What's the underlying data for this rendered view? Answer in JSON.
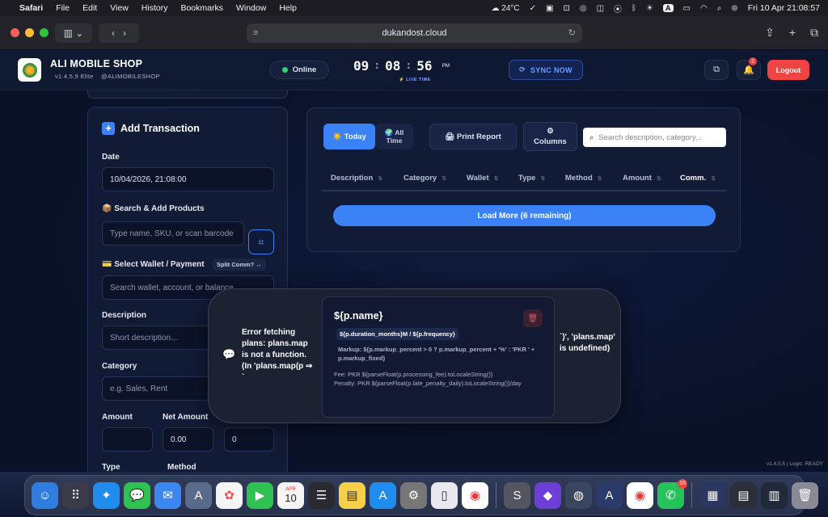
{
  "menubar": {
    "app": "Safari",
    "items": [
      "File",
      "Edit",
      "View",
      "History",
      "Bookmarks",
      "Window",
      "Help"
    ],
    "weather": "24°C",
    "input_source": "A",
    "datetime": "Fri 10 Apr  21:08:57"
  },
  "browser": {
    "url": "dukandost.cloud"
  },
  "header": {
    "shop_name": "ALI MOBILE SHOP",
    "version": "v1.4.5.9 Elite",
    "handle": "@ALIMOBILESHOP",
    "status": "Online",
    "clock": {
      "hh": "09",
      "mm": "08",
      "ss": "56",
      "ampm": "PM"
    },
    "live_label": "⚡ LIVE TIME",
    "sync_label": "SYNC NOW",
    "notif_count": "2",
    "logout_label": "Logout",
    "colors": {
      "accent": "#3b82f6",
      "danger": "#ef4444",
      "online": "#2ed573"
    }
  },
  "add_transaction": {
    "title": "Add Transaction",
    "date_label": "Date",
    "date_value": "10/04/2026, 21:08:00",
    "products_label": "📦 Search & Add Products",
    "products_placeholder": "Type name, SKU, or scan barcode",
    "wallet_label": "💳 Select Wallet / Payment",
    "split_label": "Split Comm? ↔",
    "wallet_placeholder": "Search wallet, account, or balance",
    "description_label": "Description",
    "description_placeholder": "Short description...",
    "category_label": "Category",
    "category_placeholder": "e.g. Sales, Rent",
    "amount_label": "Amount",
    "net_amount_label": "Net Amount",
    "net_amount_value": "0.00",
    "third_value": "0",
    "type_label": "Type",
    "method_label": "Method"
  },
  "transactions": {
    "tab_today": "☀️ Today",
    "tab_all_1": "🌍 All",
    "tab_all_2": "Time",
    "print_label": "🖨 Print Report",
    "columns_icon": "⚙",
    "columns_label": "Columns",
    "search_placeholder": "Search description, category...",
    "headers": [
      "Description",
      "Category",
      "Wallet",
      "Type",
      "Method",
      "Amount",
      "Comm."
    ],
    "load_more": "Load More (6 remaining)"
  },
  "error_toast": {
    "message_left": "Error fetching plans: plans.map is not a function. (In 'plans.map(p ⇒ `",
    "plan_name": "${p.name}",
    "plan_tag": "${p.duration_months}M / ${p.frequency}",
    "plan_markup": "Markup: ${p.markup_percent > 0 ? p.markup_percent + '%' : 'PKR ' + p.markup_fixed}",
    "plan_fee": "Fee: PKR ${parseFloat(p.processing_fee).toLocaleString()}",
    "plan_penalty": "Penalty: PKR ${parseFloat(p.late_penalty_daily).toLocaleString()}/day",
    "message_right": "`)', 'plans.map' is undefined)"
  },
  "footer": {
    "version": "v1.4.5.5 | Logic: READY"
  },
  "dock": {
    "calendar_day": "10",
    "calendar_month": "APR",
    "whatsapp_badge": "15"
  }
}
